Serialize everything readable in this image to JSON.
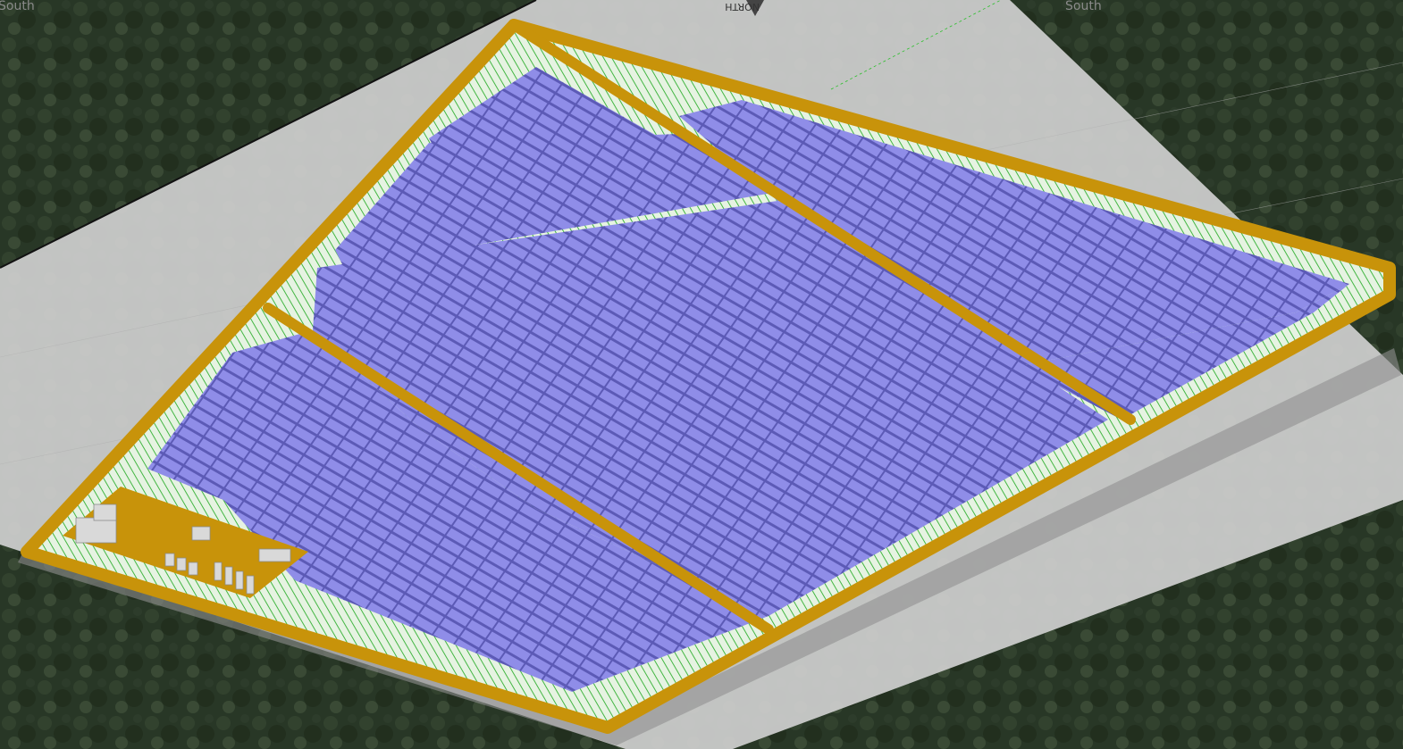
{
  "compass": {
    "south_label": "South",
    "south_label_left": "South",
    "north_label": "NORTH"
  },
  "colors": {
    "panel_fill": "#8c8ae6",
    "panel_stroke": "#5a58b8",
    "road": "#c8930a",
    "ground": "#c8c8c8",
    "grass_hatch": "#4fbf4f",
    "building": "#d8d8d8"
  },
  "elements": {
    "terrain": "aerial-terrain-image",
    "site_plane": "site-ground-plane",
    "boundary_road": "perimeter-road",
    "equipment_yard": "substation-yard"
  }
}
